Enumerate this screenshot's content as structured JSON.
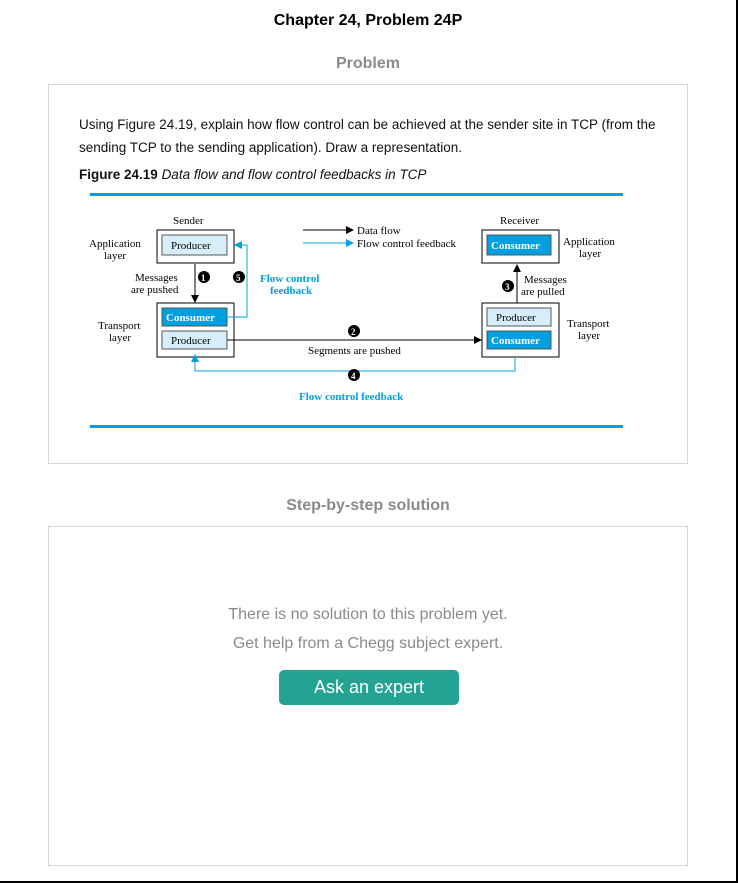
{
  "page": {
    "title": "Chapter 24, Problem 24P",
    "problem_label": "Problem",
    "solution_label": "Step-by-step solution"
  },
  "problem": {
    "text": "Using Figure 24.19, explain how flow control can be achieved at the sender site in TCP (from the sending TCP to the sending application). Draw a representation.",
    "figure_number": "Figure 24.19",
    "figure_title": "Data flow and flow control feedbacks in TCP"
  },
  "figure": {
    "sender": "Sender",
    "receiver": "Receiver",
    "application_layer_1": "Application",
    "application_layer_2": "layer",
    "transport_layer_1": "Transport",
    "transport_layer_2": "layer",
    "producer": "Producer",
    "consumer": "Consumer",
    "legend_data_flow": "Data flow",
    "legend_feedback": "Flow control feedback",
    "messages_pushed_1": "Messages",
    "messages_pushed_2": "are pushed",
    "messages_pulled_1": "Messages",
    "messages_pulled_2": "are pulled",
    "flow_control_1": "Flow control",
    "flow_control_2": "feedback",
    "segments_pushed": "Segments are pushed",
    "flow_control_bottom": "Flow control feedback",
    "step_1": "1",
    "step_2": "2",
    "step_3": "3",
    "step_4": "4",
    "step_5": "5",
    "colors": {
      "accent_blue": "#00a0e0",
      "light_box": "#d6eef9",
      "dark_box": "#00a0e0"
    }
  },
  "solution": {
    "empty_line_1": "There is no solution to this problem yet.",
    "empty_line_2": "Get help from a Chegg subject expert.",
    "ask_button": "Ask an expert"
  }
}
